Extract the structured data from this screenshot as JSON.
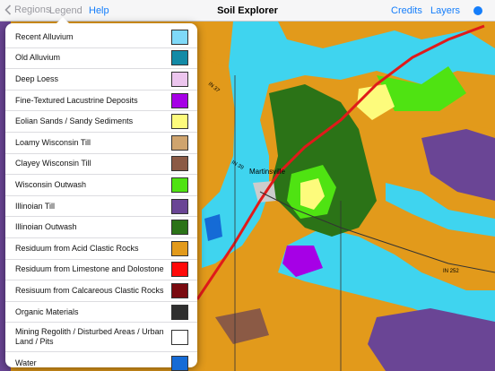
{
  "topbar": {
    "back_label": "Regions",
    "legend_label": "Legend",
    "help_label": "Help",
    "title": "Soil Explorer",
    "credits_label": "Credits",
    "layers_label": "Layers",
    "location_icon": "location-dot-icon"
  },
  "legend": {
    "items": [
      {
        "label": "Recent Alluvium",
        "color": "#7fd9f8"
      },
      {
        "label": "Old Alluvium",
        "color": "#138aa6"
      },
      {
        "label": "Deep Loess",
        "color": "#ecc5ee"
      },
      {
        "label": "Fine-Textured Lacustrine Deposits",
        "color": "#a600e6"
      },
      {
        "label": "Eolian Sands / Sandy Sediments",
        "color": "#fdfb7c"
      },
      {
        "label": "Loamy Wisconsin Till",
        "color": "#cfa46e"
      },
      {
        "label": "Clayey Wisconsin Till",
        "color": "#8b5a45"
      },
      {
        "label": "Wisconsin Outwash",
        "color": "#4fe312"
      },
      {
        "label": "Illinoian Till",
        "color": "#6a4595"
      },
      {
        "label": "Illinoian Outwash",
        "color": "#2b7317"
      },
      {
        "label": "Residuum from Acid Clastic Rocks",
        "color": "#e29a1b"
      },
      {
        "label": "Residuum from Limestone and Dolostone",
        "color": "#ff0a0a"
      },
      {
        "label": "Resisuum from Calcareous Clastic Rocks",
        "color": "#7a0a10"
      },
      {
        "label": "Organic Materials",
        "color": "#2f2f2f"
      },
      {
        "label": "Mining Regolith / Disturbed Areas / Urban Land / Pits",
        "color": "#ffffff"
      },
      {
        "label": "Water",
        "color": "#156bd6"
      }
    ]
  },
  "map": {
    "place_label": "Martinsville",
    "road_labels": [
      "IN 252",
      "IN 39",
      "IN 37"
    ],
    "colors": {
      "orange": "#e29a1b",
      "cyan": "#3fd4ef",
      "darkgreen": "#2b7317",
      "green": "#4fe312",
      "purple": "#6a4595",
      "yellow": "#fdfb7c",
      "road": "#e01a1a"
    }
  }
}
